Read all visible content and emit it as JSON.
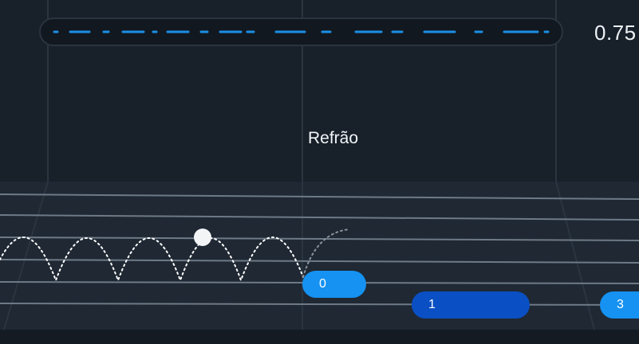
{
  "header": {
    "score": "0.75"
  },
  "lyrics": {
    "section_label": "Refrão"
  },
  "notes": [
    {
      "label": "0",
      "state": "current"
    },
    {
      "label": "1",
      "state": "upcoming-long"
    },
    {
      "label": "3",
      "state": "upcoming"
    }
  ],
  "icons": {
    "ball": "bouncing-ball-icon",
    "progress": "song-progress-icon"
  },
  "colors": {
    "background": "#18202a",
    "lane_line": "#6e7a87",
    "progress_dash": "#1b8fe6",
    "note_blue": "#1592f2",
    "note_dark_blue": "#0a50c4",
    "ball": "#f2f4f6"
  }
}
